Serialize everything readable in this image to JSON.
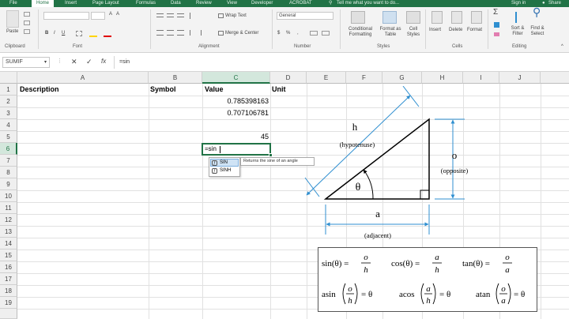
{
  "tabs": [
    "File",
    "Home",
    "Insert",
    "Page Layout",
    "Formulas",
    "Data",
    "Review",
    "View",
    "Developer",
    "ACROBAT",
    "Tell me what you want to do...",
    "Sign in",
    "Share"
  ],
  "active_tab": "Home",
  "ribbon": {
    "clipboard": {
      "paste_label": "Paste",
      "group_label": "Clipboard"
    },
    "font": {
      "group_label": "Font"
    },
    "alignment": {
      "wrap_text": "Wrap Text",
      "merge_center": "Merge & Center",
      "group_label": "Alignment"
    },
    "number": {
      "format_value": "General",
      "group_label": "Number"
    },
    "styles": {
      "conditional": "Conditional Formatting",
      "format_table": "Format as Table",
      "cell_styles": "Cell Styles",
      "group_label": "Styles"
    },
    "cells": {
      "insert": "Insert",
      "delete": "Delete",
      "format": "Format",
      "group_label": "Cells"
    },
    "editing": {
      "sort_filter": "Sort & Filter",
      "find_select": "Find & Select",
      "group_label": "Editing"
    }
  },
  "formula_bar": {
    "name_box": "SUMIF",
    "fx_label": "fx",
    "formula": "=sin"
  },
  "columns": [
    "A",
    "B",
    "C",
    "D",
    "E",
    "F",
    "G",
    "H",
    "I",
    "J"
  ],
  "selected_column": "C",
  "rows": [
    "1",
    "2",
    "3",
    "4",
    "5",
    "6",
    "7",
    "8",
    "9",
    "10",
    "11",
    "12",
    "13",
    "14",
    "15",
    "16",
    "17",
    "18",
    "19"
  ],
  "selected_row": "6",
  "cells": {
    "a1": "Description",
    "b1": "Symbol",
    "c1": "Value",
    "d1": "Unit",
    "c2": "0.785398163",
    "c3": "0.707106781",
    "c5": "45",
    "c6": "=sin"
  },
  "autocomplete": {
    "items": [
      "SIN",
      "SINH"
    ],
    "tooltip": "Returns the sine of an angle"
  },
  "figure": {
    "h": "h",
    "hypotenuse": "(hypotenuse)",
    "o": "o",
    "opposite": "(opposite)",
    "a": "a",
    "adjacent": "(adjacent)",
    "theta": "θ",
    "formulas": {
      "sin_lhs": "sin(θ) =",
      "sin_num": "o",
      "sin_den": "h",
      "cos_lhs": "cos(θ) =",
      "cos_num": "a",
      "cos_den": "h",
      "tan_lhs": "tan(θ) =",
      "tan_num": "o",
      "tan_den": "a",
      "asin_lhs": "asin",
      "asin_num": "o",
      "asin_den": "h",
      "asin_rhs": "= θ",
      "acos_lhs": "acos",
      "acos_num": "a",
      "acos_den": "h",
      "acos_rhs": "= θ",
      "atan_lhs": "atan",
      "atan_num": "o",
      "atan_den": "a",
      "atan_rhs": "= θ"
    }
  },
  "colors": {
    "excel_green": "#217346",
    "diagram_blue": "#2f8fd0",
    "selection_green": "#d3e7dc"
  }
}
